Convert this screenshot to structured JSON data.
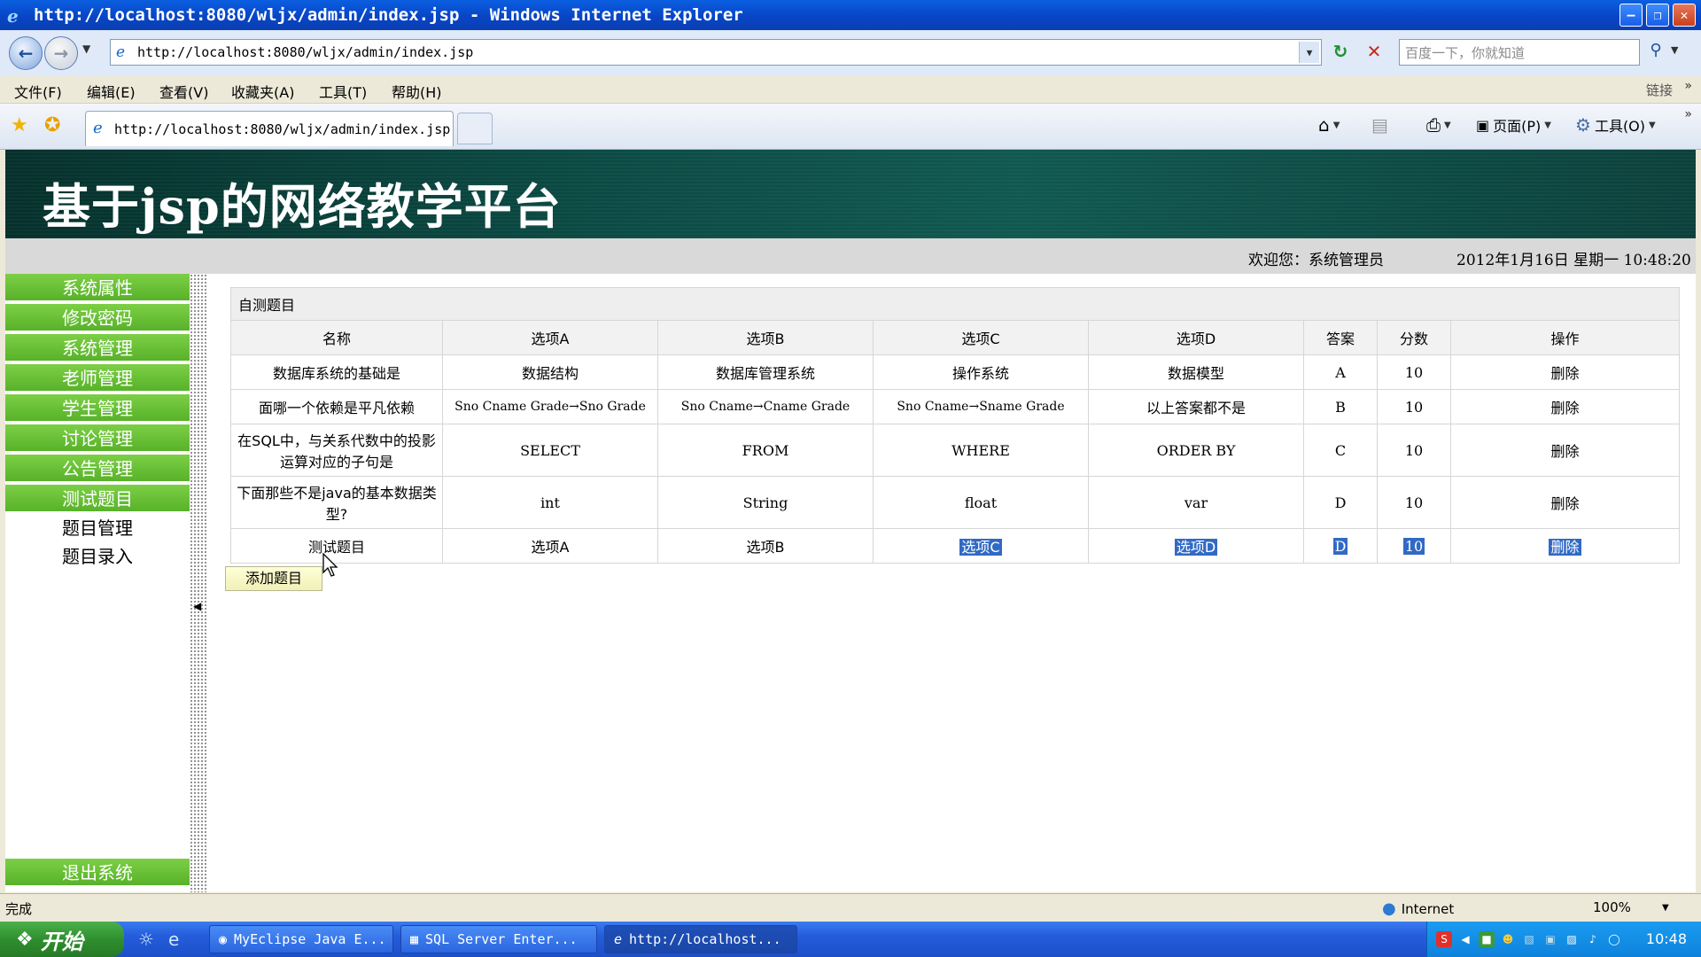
{
  "window": {
    "title": "http://localhost:8080/wljx/admin/index.jsp - Windows Internet Explorer"
  },
  "address": {
    "url": "http://localhost:8080/wljx/admin/index.jsp",
    "search_placeholder": "百度一下，你就知道"
  },
  "menu": {
    "items": [
      "文件(F)",
      "编辑(E)",
      "查看(V)",
      "收藏夹(A)",
      "工具(T)",
      "帮助(H)"
    ],
    "links_label": "链接"
  },
  "tab": {
    "title": "http://localhost:8080/wljx/admin/index.jsp"
  },
  "commandbar": {
    "page_label": "页面(P)",
    "tools_label": "工具(O)"
  },
  "page": {
    "banner_title": "基于jsp的网络教学平台",
    "welcome": "欢迎您：系统管理员",
    "datetime": "2012年1月16日 星期一 10:48:20",
    "sidebar": {
      "items": [
        "系统属性",
        "修改密码",
        "系统管理",
        "老师管理",
        "学生管理",
        "讨论管理",
        "公告管理",
        "测试题目"
      ],
      "sub_items": [
        "题目管理",
        "题目录入"
      ],
      "logout": "退出系统"
    },
    "table": {
      "caption": "自测题目",
      "headers": [
        "名称",
        "选项A",
        "选项B",
        "选项C",
        "选项D",
        "答案",
        "分数",
        "操作"
      ],
      "rows": [
        [
          "数据库系统的基础是",
          "数据结构",
          "数据库管理系统",
          "操作系统",
          "数据模型",
          "A",
          "10",
          "删除"
        ],
        [
          "面哪一个依赖是平凡依赖",
          "Sno Cname Grade→Sno Grade",
          "Sno Cname→Cname Grade",
          "Sno Cname→Sname Grade",
          "以上答案都不是",
          "B",
          "10",
          "删除"
        ],
        [
          "在SQL中，与关系代数中的投影运算对应的子句是",
          "SELECT",
          "FROM",
          "WHERE",
          "ORDER BY",
          "C",
          "10",
          "删除"
        ],
        [
          "下面那些不是java的基本数据类型?",
          "int",
          "String",
          "float",
          "var",
          "D",
          "10",
          "删除"
        ],
        [
          "测试题目",
          "选项A",
          "选项B",
          "选项C",
          "选项D",
          "D",
          "10",
          "删除"
        ]
      ]
    },
    "add_button": "添加题目"
  },
  "status": {
    "text": "完成",
    "zone": "Internet",
    "zoom": "100%"
  },
  "taskbar": {
    "start": "开始",
    "tasks": [
      "MyEclipse Java E...",
      "SQL Server Enter...",
      "http://localhost..."
    ],
    "clock": "10:48"
  }
}
